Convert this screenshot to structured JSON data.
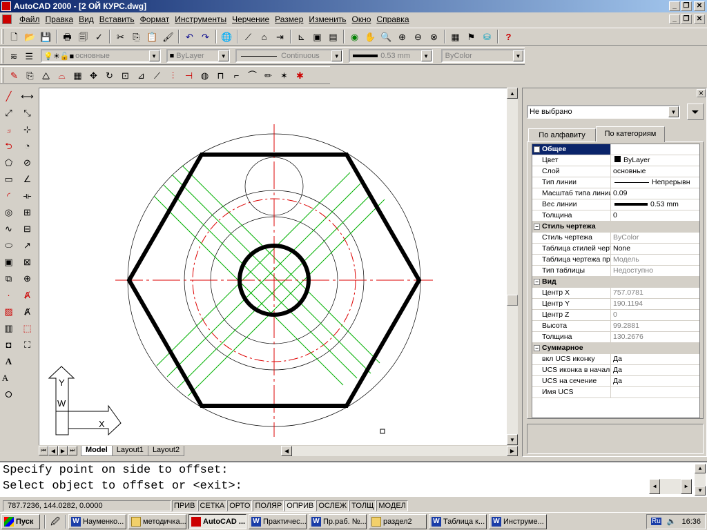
{
  "window": {
    "title": "AutoCAD 2000 - [2 ОЙ КУРС.dwg]"
  },
  "menu": [
    "Файл",
    "Правка",
    "Вид",
    "Вставить",
    "Формат",
    "Инструменты",
    "Черчение",
    "Размер",
    "Изменить",
    "Окно",
    "Справка"
  ],
  "layer_bar": {
    "layer": "основные",
    "color": "ByLayer",
    "linetype": "Continuous",
    "lineweight": "0.53 mm",
    "plotstyle": "ByColor"
  },
  "layout_tabs": [
    "Model",
    "Layout1",
    "Layout2"
  ],
  "ucs": {
    "x": "X",
    "y": "Y",
    "w": "W"
  },
  "properties": {
    "selection": "Не выбрано",
    "tabs": [
      "По алфавиту",
      "По категориям"
    ],
    "rows": [
      {
        "cat": true,
        "name": "Общее"
      },
      {
        "name": "Цвет",
        "value": "ByLayer"
      },
      {
        "name": "Слой",
        "value": "основные"
      },
      {
        "name": "Тип линии",
        "value": "Непрерывн"
      },
      {
        "name": "Масштаб типа линии",
        "value": "0.09"
      },
      {
        "name": "Вес линии",
        "value": "0.53 mm"
      },
      {
        "name": "Толщина",
        "value": "0"
      },
      {
        "cat": true,
        "name": "Стиль чертежа"
      },
      {
        "name": "Стиль чертежа",
        "value": "ByColor",
        "grey": true
      },
      {
        "name": "Таблица стилей черте",
        "value": "None"
      },
      {
        "name": "Таблица чертежа прив",
        "value": "Модель",
        "grey": true
      },
      {
        "name": "Тип таблицы",
        "value": "Недоступно",
        "grey": true
      },
      {
        "cat": true,
        "name": "Вид"
      },
      {
        "name": "Центр X",
        "value": "757.0781",
        "grey": true
      },
      {
        "name": "Центр Y",
        "value": "190.1194",
        "grey": true
      },
      {
        "name": "Центр Z",
        "value": "0",
        "grey": true
      },
      {
        "name": "Высота",
        "value": "99.2881",
        "grey": true
      },
      {
        "name": "Толщина",
        "value": "130.2676",
        "grey": true
      },
      {
        "cat": true,
        "name": "Суммарное"
      },
      {
        "name": "вкл UCS иконку",
        "value": "Да"
      },
      {
        "name": "UCS иконка в начале к",
        "value": "Да"
      },
      {
        "name": "UCS на сечение",
        "value": "Да"
      },
      {
        "name": "Имя UCS",
        "value": ""
      }
    ]
  },
  "command": {
    "line1": "Specify point on side to offset:",
    "line2": "Select object to offset or <exit>:"
  },
  "status": {
    "coords": "787.7236, 144.0282, 0.0000",
    "toggles": [
      "ПРИВ",
      "СЕТКА",
      "ОРТО",
      "ПОЛЯР",
      "ОПРИВ",
      "ОСЛЕЖ",
      "ТОЛЩ",
      "МОДЕЛ"
    ]
  },
  "taskbar": {
    "start": "Пуск",
    "tasks": [
      "Науменко...",
      "методичка...",
      "AutoCAD ...",
      "Практичес...",
      "Пр.раб. №...",
      "раздел2",
      "Таблица к...",
      "Инструме..."
    ],
    "lang": "Ru",
    "time": "16:36"
  },
  "colors": {
    "center_line": "#dd0000",
    "hatch_line": "#00b000",
    "title_dark": "#0a246a",
    "title_light": "#a6caf0"
  }
}
